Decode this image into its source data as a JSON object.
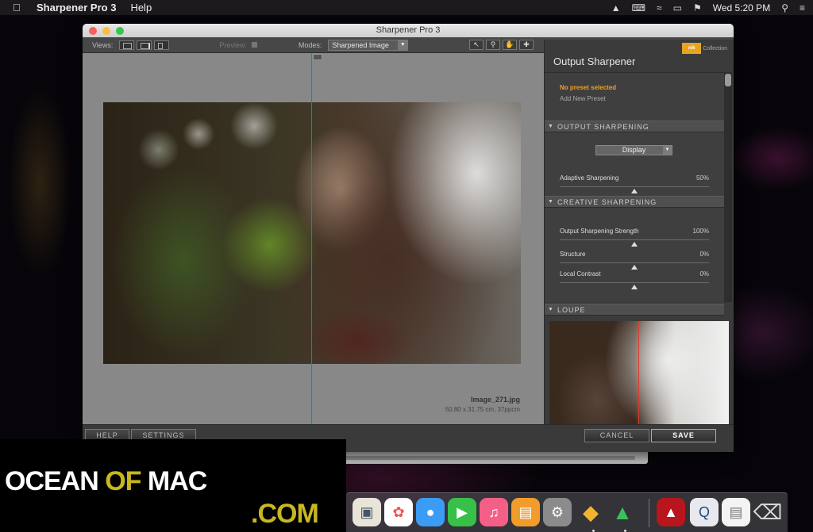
{
  "menubar": {
    "app_name": "Sharpener Pro 3",
    "menu_help": "Help",
    "clock": "Wed 5:20 PM"
  },
  "window": {
    "title": "Sharpener Pro 3",
    "toolbar": {
      "views_label": "Views:",
      "preview_label": "Preview:",
      "modes_label": "Modes:",
      "modes_value": "Sharpened Image"
    },
    "file_name": "Image_271.jpg",
    "file_info": "50.80 x 31.75 cm, 37ppcm"
  },
  "panel": {
    "title": "Output Sharpener",
    "logo_text": "nik",
    "logo_sub": "Collection",
    "preset_selected": "No preset selected",
    "preset_add": "Add New Preset",
    "sections": {
      "output": "OUTPUT SHARPENING",
      "creative": "CREATIVE SHARPENING",
      "loupe": "LOUPE"
    },
    "display_select": "Display",
    "sliders": [
      {
        "label": "Adaptive Sharpening",
        "value": "50%",
        "level": 0.5
      },
      {
        "label": "Output Sharpening Strength",
        "value": "100%",
        "level": 0.5
      },
      {
        "label": "Structure",
        "value": "0%",
        "level": 0.5
      },
      {
        "label": "Local Contrast",
        "value": "0%",
        "level": 0.5
      }
    ]
  },
  "bottombar": {
    "help": "HELP",
    "settings": "SETTINGS",
    "cancel": "CANCEL",
    "save": "SAVE"
  },
  "watermark": {
    "part1": "OCEAN",
    "part2": "OF",
    "part3": "MAC",
    "part4": ".COM"
  },
  "dock": {
    "icons": [
      "preview-icon",
      "photos-icon",
      "messages-icon",
      "facetime-icon",
      "itunes-icon",
      "ibooks-icon",
      "system-preferences-icon",
      "pencil-app-icon",
      "green-app-icon",
      "acrobat-icon",
      "quicktime-icon",
      "finder-doc-icon",
      "trash-icon"
    ]
  }
}
